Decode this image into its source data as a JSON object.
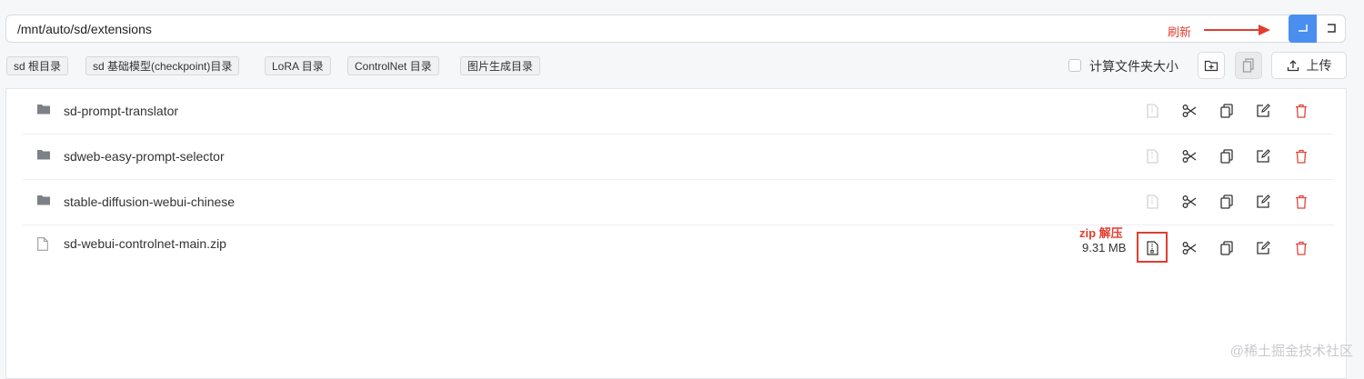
{
  "path": {
    "value": "/mnt/auto/sd/extensions"
  },
  "annotations": {
    "refresh": "刷新",
    "unzip": "zip 解压"
  },
  "quick_dirs": [
    {
      "label": "sd 根目录"
    },
    {
      "label": "sd 基础模型(checkpoint)目录"
    },
    {
      "label": "LoRA 目录"
    },
    {
      "label": "ControlNet 目录"
    },
    {
      "label": "图片生成目录"
    }
  ],
  "toolbar": {
    "calc_folder_size_label": "计算文件夹大小",
    "calc_folder_size_checked": false,
    "upload_label": "上传"
  },
  "files": [
    {
      "name": "sd-prompt-translator",
      "type": "folder",
      "size": ""
    },
    {
      "name": "sdweb-easy-prompt-selector",
      "type": "folder",
      "size": ""
    },
    {
      "name": "stable-diffusion-webui-chinese",
      "type": "folder",
      "size": ""
    },
    {
      "name": "sd-webui-controlnet-main.zip",
      "type": "file",
      "size": "9.31 MB"
    }
  ],
  "watermark": "@稀土掘金技术社区",
  "colors": {
    "accent": "#4a8ef0",
    "annotation": "#e03e2f",
    "delete": "#e0453a"
  }
}
